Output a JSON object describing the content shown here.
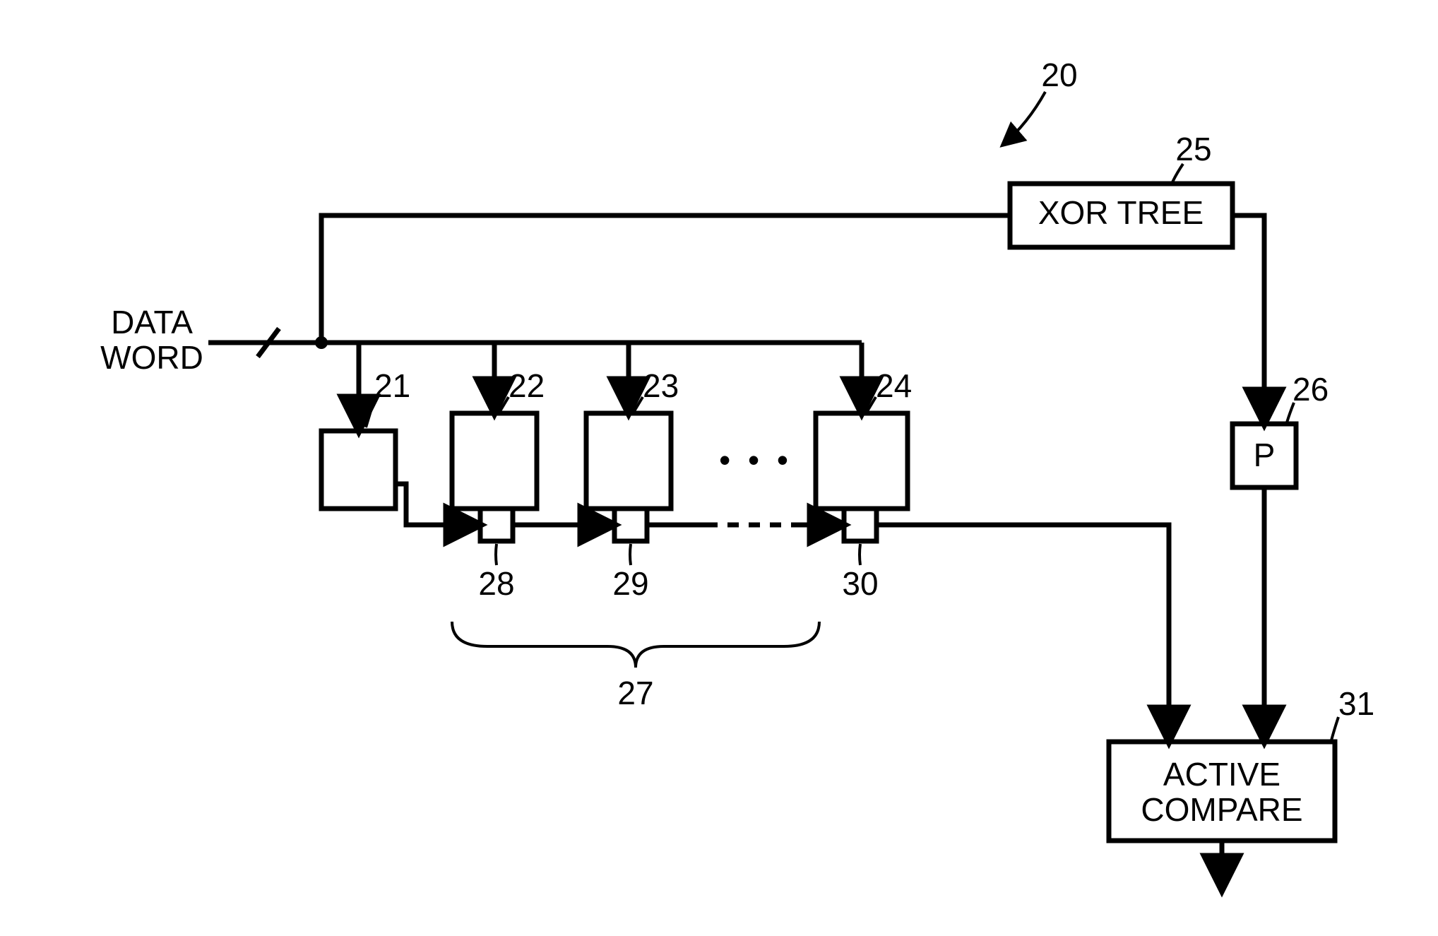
{
  "labels": {
    "sys_ref": "20",
    "xor_tree": "XOR TREE",
    "xor_tree_ref": "25",
    "data_word_line1": "DATA",
    "data_word_line2": "WORD",
    "reg0_ref": "21",
    "reg1_ref": "22",
    "reg2_ref": "23",
    "regN_ref": "24",
    "p_box": "P",
    "p_box_ref": "26",
    "xb1_ref": "28",
    "xb2_ref": "29",
    "xbN_ref": "30",
    "brace_ref": "27",
    "compare_ref": "31",
    "compare_line1": "ACTIVE",
    "compare_line2": "COMPARE",
    "ellipsis": "• • •"
  }
}
